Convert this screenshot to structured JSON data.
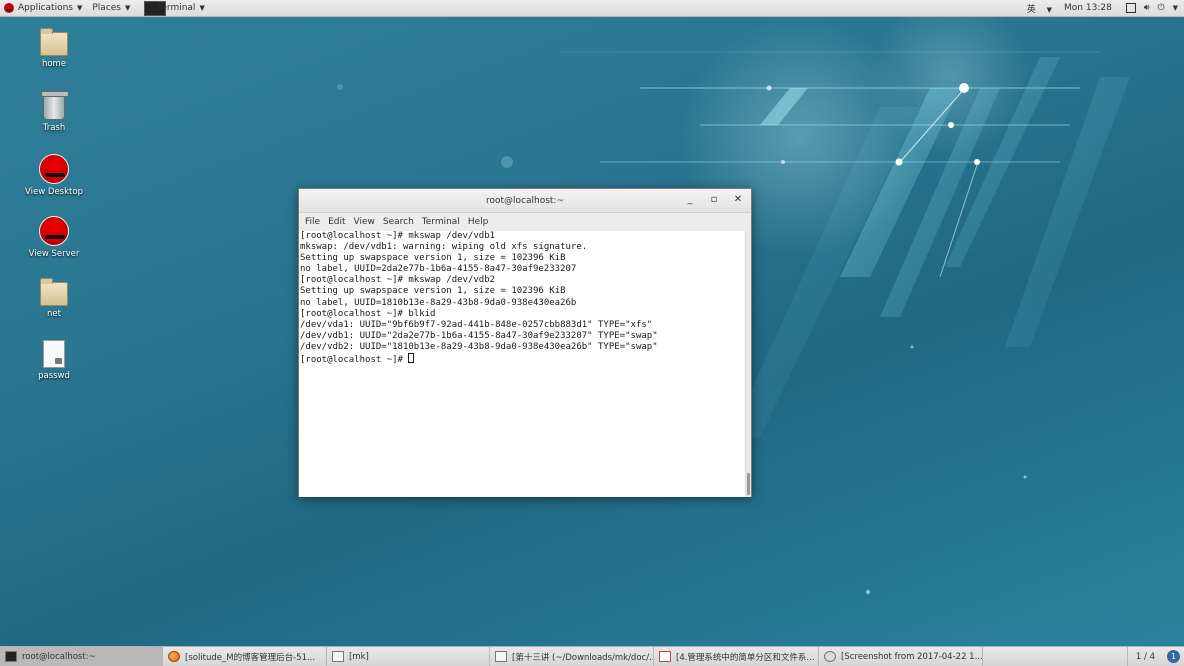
{
  "top_panel": {
    "applications": "Applications",
    "places": "Places",
    "terminal": "Terminal",
    "input_method": "英",
    "clock": "Mon 13:28"
  },
  "desktop_icons": [
    {
      "label": "home",
      "icon": "folder-home-icon"
    },
    {
      "label": "Trash",
      "icon": "trash-icon"
    },
    {
      "label": "View Desktop",
      "icon": "redhat-icon"
    },
    {
      "label": "View Server",
      "icon": "redhat-icon"
    },
    {
      "label": "net",
      "icon": "folder-icon"
    },
    {
      "label": "passwd",
      "icon": "locked-file-icon"
    }
  ],
  "window": {
    "title": "root@localhost:~",
    "menu": [
      "File",
      "Edit",
      "View",
      "Search",
      "Terminal",
      "Help"
    ],
    "lines": [
      "[root@localhost ~]# mkswap /dev/vdb1",
      "mkswap: /dev/vdb1: warning: wiping old xfs signature.",
      "Setting up swapspace version 1, size = 102396 KiB",
      "no label, UUID=2da2e77b-1b6a-4155-8a47-30af9e233207",
      "[root@localhost ~]# mkswap /dev/vdb2",
      "Setting up swapspace version 1, size = 102396 KiB",
      "no label, UUID=1810b13e-8a29-43b8-9da0-938e430ea26b",
      "[root@localhost ~]# blkid",
      "/dev/vda1: UUID=\"9bf6b9f7-92ad-441b-848e-0257cbb883d1\" TYPE=\"xfs\"",
      "/dev/vdb1: UUID=\"2da2e77b-1b6a-4155-8a47-30af9e233207\" TYPE=\"swap\"",
      "/dev/vdb2: UUID=\"1810b13e-8a29-43b8-9da0-938e430ea26b\" TYPE=\"swap\""
    ],
    "prompt": "[root@localhost ~]# "
  },
  "taskbar": {
    "tasks": [
      {
        "label": "root@localhost:~",
        "icon": "terminal-icon",
        "active": true
      },
      {
        "label": "[solitude_M的博客管理后台-51...",
        "icon": "firefox-icon",
        "active": false
      },
      {
        "label": "[mk]",
        "icon": "file-manager-icon",
        "active": false
      },
      {
        "label": "[第十三讲 (~/Downloads/mk/doc/...",
        "icon": "text-editor-icon",
        "active": false
      },
      {
        "label": "[4.管理系统中的简单分区和文件系...",
        "icon": "pdf-icon",
        "active": false
      },
      {
        "label": "[Screenshot from 2017-04-22 1...",
        "icon": "screenshot-icon",
        "active": false
      }
    ],
    "pager": "1 / 4",
    "notify": "1"
  },
  "colors": {
    "desktop": "#2a7690",
    "panel": "#e3e3e3",
    "terminal_bg": "#ffffff"
  }
}
